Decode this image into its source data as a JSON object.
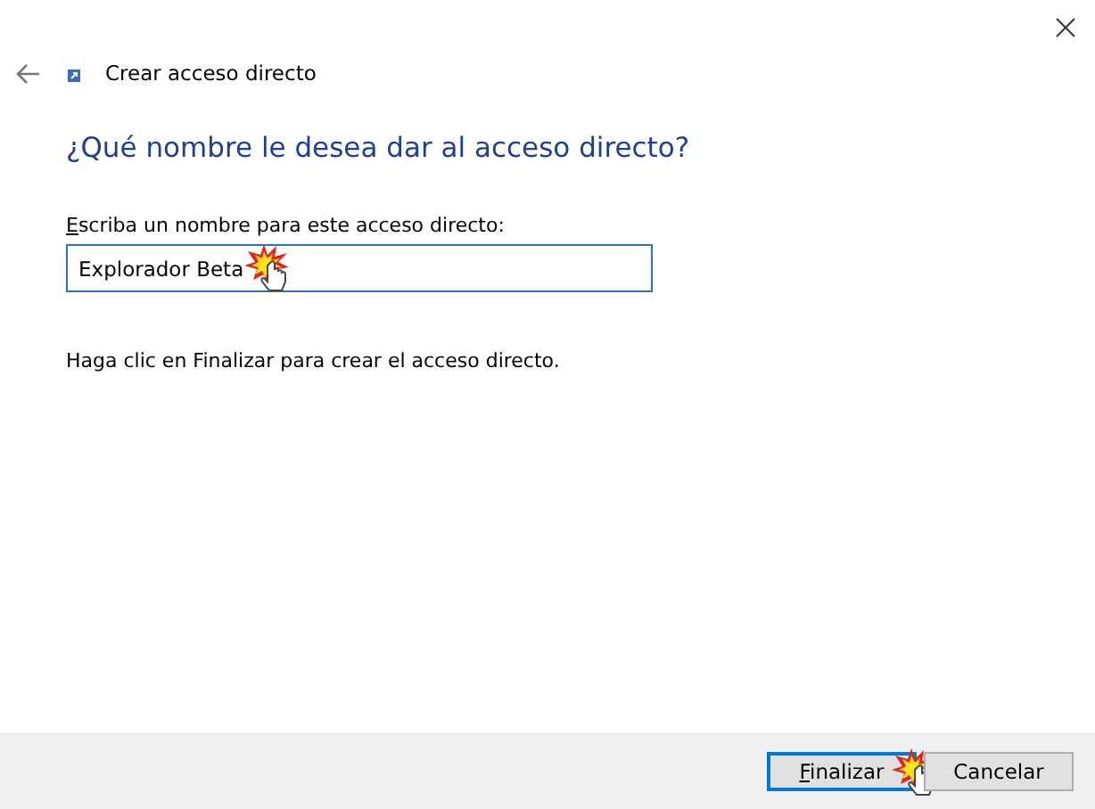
{
  "window": {
    "title": "Crear acceso directo"
  },
  "heading": "¿Qué nombre le desea dar al acceso directo?",
  "name_field": {
    "label": "Escriba un nombre para este acceso directo:",
    "first_letter_underlined": true,
    "value": "Explorador Beta",
    "click_marker": true
  },
  "instruction": "Haga clic en Finalizar para crear el acceso directo.",
  "buttons": [
    {
      "label": "Finalizar",
      "default": true,
      "first_letter_underlined": true,
      "click_marker": true
    },
    {
      "label": "Cancelar",
      "default": false,
      "first_letter_underlined": false,
      "click_marker": false
    }
  ]
}
